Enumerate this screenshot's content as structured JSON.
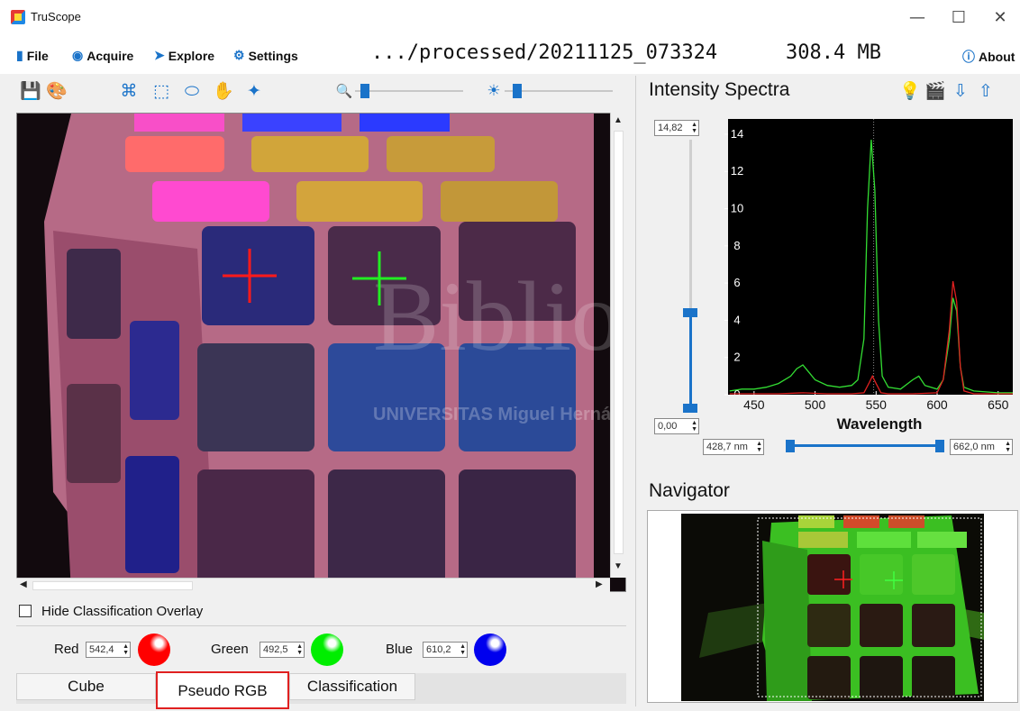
{
  "window": {
    "title": "TruScope",
    "controls": {
      "minimize": "—",
      "maximize": "☐",
      "close": "✕"
    }
  },
  "menu": {
    "items": [
      {
        "label": "File",
        "icon": "file-icon"
      },
      {
        "label": "Acquire",
        "icon": "camera-icon"
      },
      {
        "label": "Explore",
        "icon": "compass-icon"
      },
      {
        "label": "Settings",
        "icon": "gear-icon"
      }
    ],
    "path": ".../processed/20211125_073324",
    "size": "308.4 MB",
    "about": "About"
  },
  "toolbar": {
    "left_icons": [
      "save-icon",
      "palette-icon",
      "crop-icon",
      "select-rect-icon",
      "lasso-icon",
      "pan-hand-icon",
      "magic-wand-icon"
    ],
    "zoom_icon": "zoom-icon",
    "brightness_icon": "brightness-icon",
    "zoom_level": 0.05,
    "brightness_level": 0.08
  },
  "spectra": {
    "title": "Intensity Spectra",
    "icons": [
      "bulb-icon",
      "clapperboard-icon",
      "export-icon",
      "share-icon"
    ],
    "ymax_value": "14,82",
    "ymin_value": "0,00",
    "wl_min_value": "428,7 nm",
    "wl_max_value": "662,0 nm",
    "chart_data": {
      "type": "line",
      "xlabel": "Wavelength",
      "ylabel": "",
      "xlim": [
        428.7,
        662.0
      ],
      "ylim": [
        0,
        14.82
      ],
      "xticks": [
        450,
        500,
        550,
        600,
        650
      ],
      "yticks": [
        0,
        2,
        4,
        6,
        8,
        10,
        12,
        14
      ],
      "series": [
        {
          "color": "#33dd33",
          "x": [
            430,
            440,
            450,
            460,
            470,
            480,
            485,
            490,
            495,
            500,
            510,
            520,
            530,
            535,
            540,
            543,
            546,
            549,
            552,
            555,
            560,
            570,
            580,
            585,
            590,
            600,
            605,
            610,
            613,
            616,
            619,
            622,
            630,
            640,
            650,
            662
          ],
          "y": [
            0.2,
            0.3,
            0.3,
            0.4,
            0.6,
            1.0,
            1.4,
            1.6,
            1.2,
            0.8,
            0.5,
            0.4,
            0.5,
            0.8,
            3.0,
            10.0,
            13.7,
            11.0,
            4.0,
            1.0,
            0.4,
            0.3,
            0.8,
            1.0,
            0.5,
            0.3,
            0.8,
            3.0,
            5.2,
            4.5,
            1.5,
            0.4,
            0.2,
            0.15,
            0.1,
            0.1
          ]
        },
        {
          "color": "#e02020",
          "x": [
            430,
            450,
            470,
            490,
            510,
            530,
            540,
            544,
            547,
            550,
            554,
            560,
            580,
            600,
            605,
            610,
            613,
            616,
            619,
            622,
            630,
            662
          ],
          "y": [
            0.05,
            0.05,
            0.05,
            0.1,
            0.05,
            0.05,
            0.1,
            0.6,
            1.0,
            0.6,
            0.1,
            0.05,
            0.05,
            0.1,
            0.8,
            3.5,
            6.1,
            5.0,
            1.5,
            0.2,
            0.05,
            0.05
          ]
        }
      ]
    }
  },
  "image_view": {
    "watermark_main": "Biblioteca",
    "watermark_sub": "UNIVERSITAS Miguel Hernández"
  },
  "navigator": {
    "title": "Navigator"
  },
  "controls": {
    "hide_overlay_label": "Hide Classification Overlay",
    "hide_overlay_checked": false,
    "red_label": "Red",
    "red_value": "542,4",
    "green_label": "Green",
    "green_value": "492,5",
    "blue_label": "Blue",
    "blue_value": "610,2",
    "red_color": "#ff0000",
    "green_color": "#00ee00",
    "blue_color": "#0000ee"
  },
  "tabs": [
    "Cube",
    "Pseudo RGB",
    "Classification"
  ],
  "selected_tab": "Pseudo RGB"
}
